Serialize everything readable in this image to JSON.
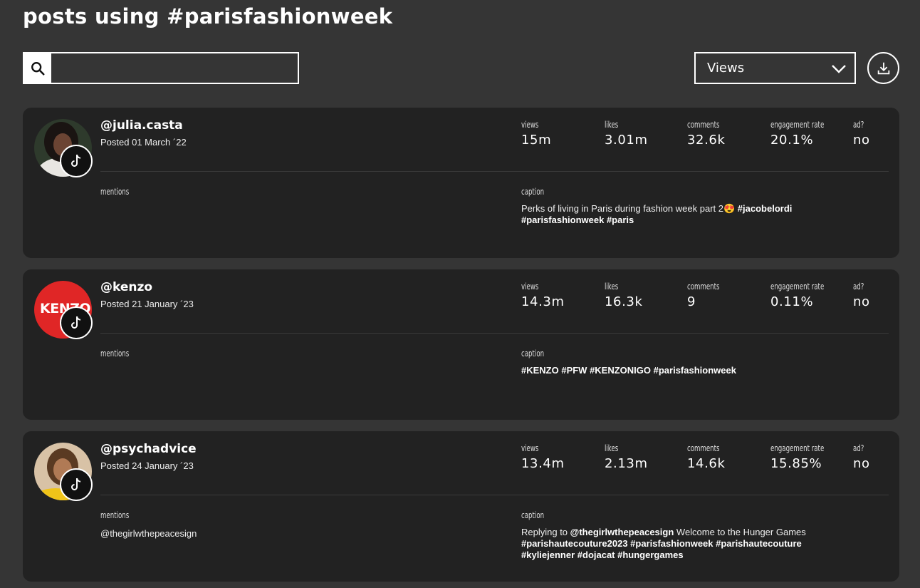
{
  "page": {
    "title": "posts using #parisfashionweek"
  },
  "toolbar": {
    "search_placeholder": "",
    "sort_selected": "Views"
  },
  "stat_labels": {
    "views": "views",
    "likes": "likes",
    "comments": "comments",
    "engagement": "engagement rate",
    "ad": "ad?"
  },
  "section_labels": {
    "mentions": "mentions",
    "caption": "caption"
  },
  "posts": [
    {
      "handle": "@julia.casta",
      "posted": "Posted 01 March ´22",
      "views": "15m",
      "likes": "3.01m",
      "comments": "32.6k",
      "engagement": "20.1%",
      "ad": "no",
      "mentions": "",
      "caption": {
        "line1_text": "Perks of living in Paris during fashion week part 2",
        "line1_emoji": "😍",
        "line1_tag": "#jacobelordi",
        "line2": "#parisfashionweek #paris"
      }
    },
    {
      "handle": "@kenzo",
      "posted": "Posted 21 January ´23",
      "avatar_text": "KENZO",
      "views": "14.3m",
      "likes": "16.3k",
      "comments": "9",
      "engagement": "0.11%",
      "ad": "no",
      "mentions": "",
      "caption": {
        "line1": "#KENZO #PFW #KENZONIGO #parisfashionweek"
      }
    },
    {
      "handle": "@psychadvice",
      "posted": "Posted 24 January ´23",
      "views": "13.4m",
      "likes": "2.13m",
      "comments": "14.6k",
      "engagement": "15.85%",
      "ad": "no",
      "mentions": "@thegirlwthepeacesign",
      "caption": {
        "prefix": "Replying to",
        "reply_to": "@thegirlwthepeacesign",
        "suffix": "Welcome to the Hunger Games",
        "line2": "#parishautecouture2023 #parisfashionweek #parishautecouture",
        "line3": "#kyliejenner #dojacat #hungergames"
      }
    }
  ],
  "colors": {
    "background": "#353535",
    "card": "#222222",
    "kenzo_red": "#e02626",
    "text": "#ffffff"
  },
  "icons": {
    "search": "search-icon",
    "sort": "chevron-down-icon",
    "download": "download-icon",
    "platform": "tiktok-icon"
  }
}
